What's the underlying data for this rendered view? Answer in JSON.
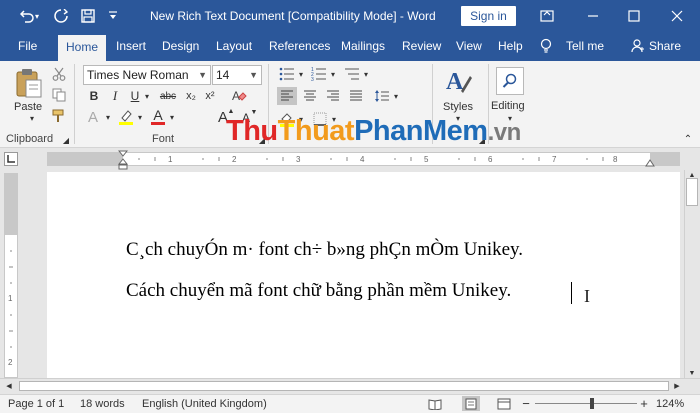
{
  "window": {
    "title": "New Rich Text Document [Compatibility Mode]  -  Word",
    "signin_label": "Sign in"
  },
  "tabs": [
    "File",
    "Home",
    "Insert",
    "Design",
    "Layout",
    "References",
    "Mailings",
    "Review",
    "View",
    "Help",
    "Tell me",
    "Share"
  ],
  "ribbon": {
    "clipboard": {
      "paste_label": "Paste",
      "group_label": "Clipboard"
    },
    "font": {
      "name": "Times New Roman",
      "size": "14",
      "group_label": "Font",
      "bold": "B",
      "italic": "I",
      "underline": "U",
      "strike": "abc",
      "subscript": "x₂",
      "superscript": "x²",
      "grow": "A",
      "shrink": "A",
      "text_effects": "A",
      "font_color": "A",
      "clear_format": "A"
    },
    "styles_label": "Styles",
    "editing_label": "Editing"
  },
  "watermark": {
    "part1": "Thu",
    "part2": "Thuat",
    "part3": "PhanMem",
    "part4": ".vn"
  },
  "document": {
    "line1": "C¸ch chuyÓn m· font ch÷ b»ng phÇn mÒm Unikey.",
    "line2": "Cách chuyển mã font chữ bằng phần mềm Unikey."
  },
  "status": {
    "page": "Page 1 of 1",
    "words": "18 words",
    "language": "English (United Kingdom)",
    "zoom": "124%"
  },
  "colors": {
    "brand": "#2b579a",
    "font_color_bar": "#e02727",
    "highlight_bar": "#ffff00"
  }
}
